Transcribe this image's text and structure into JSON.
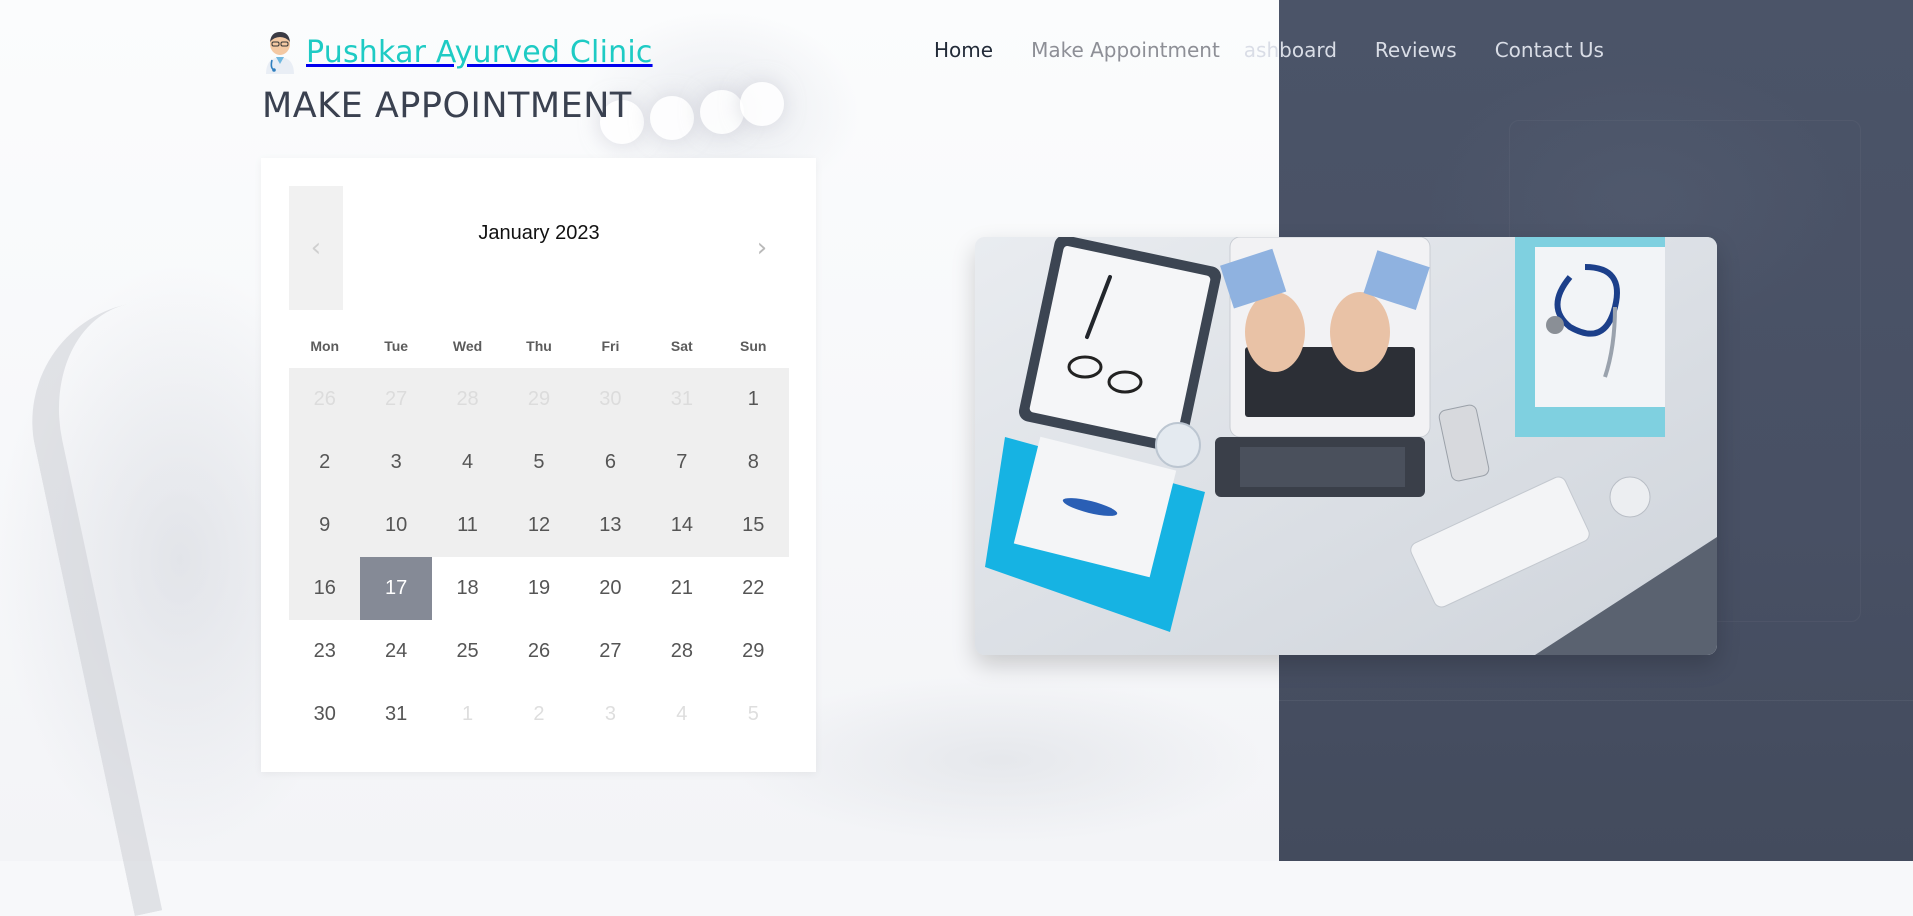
{
  "brand": {
    "name": "Pushkar Ayurved Clinic",
    "icon": "doctor-avatar-icon"
  },
  "nav": {
    "home": "Home",
    "make_appointment": "Make Appointment",
    "dashboard": "ashboard",
    "reviews": "Reviews",
    "contact": "Contact Us"
  },
  "page": {
    "title": "MAKE APPOINTMENT"
  },
  "calendar": {
    "month_label": "January 2023",
    "prev_icon": "‹",
    "next_icon": "›",
    "weekdays": [
      "Mon",
      "Tue",
      "Wed",
      "Thu",
      "Fri",
      "Sat",
      "Sun"
    ],
    "days": [
      "26",
      "27",
      "28",
      "29",
      "30",
      "31",
      "1",
      "2",
      "3",
      "4",
      "5",
      "6",
      "7",
      "8",
      "9",
      "10",
      "11",
      "12",
      "13",
      "14",
      "15",
      "16",
      "17",
      "18",
      "19",
      "20",
      "21",
      "22",
      "23",
      "24",
      "25",
      "26",
      "27",
      "28",
      "29",
      "30",
      "31",
      "1",
      "2",
      "3",
      "4",
      "5"
    ],
    "selected_day": "17"
  },
  "hero_image": {
    "icon": "doctor-desk-laptop-stethoscope-illustration"
  },
  "colors": {
    "brand": "#1ecbc4",
    "selected_day": "#858a96",
    "past_day_bg": "#efefef",
    "right_panel": "#485064"
  }
}
